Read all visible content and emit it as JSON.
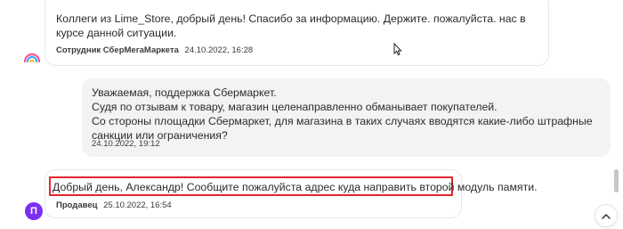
{
  "messages": [
    {
      "text": "Коллеги из Lime_Store, добрый день! Спасибо за информацию. Держите. пожалуйста. нас в курсе данной ситуации.",
      "author": "Сотрудник СберМегаМаркета",
      "timestamp": "24.10.2022, 16:28",
      "avatar_icon": "sbermegamarket-logo-icon"
    },
    {
      "text": "Уважаемая, поддержка Сбермаркет.\nСудя по отзывам к товару, магазин целенаправленно обманывает покупателей.\nСо стороны площадки Сбермаркет, для магазина в таких случаях вводятся какие-либо штрафные санкции или ограничения?",
      "timestamp": "24.10.2022, 19:12"
    },
    {
      "text": "Добрый день, Александр! Сообщите пожалуйста адрес куда направить второй модуль памяти.",
      "author": "Продавец",
      "timestamp": "25.10.2022, 16:54",
      "avatar_letter": "П"
    }
  ],
  "colors": {
    "highlight_border": "#e3262e",
    "seller_avatar": "#7b2ff2",
    "user_bubble": "#f2f3f5"
  },
  "icons": {
    "scroll_top": "chevron-up-icon",
    "cursor": "mouse-cursor-icon"
  }
}
